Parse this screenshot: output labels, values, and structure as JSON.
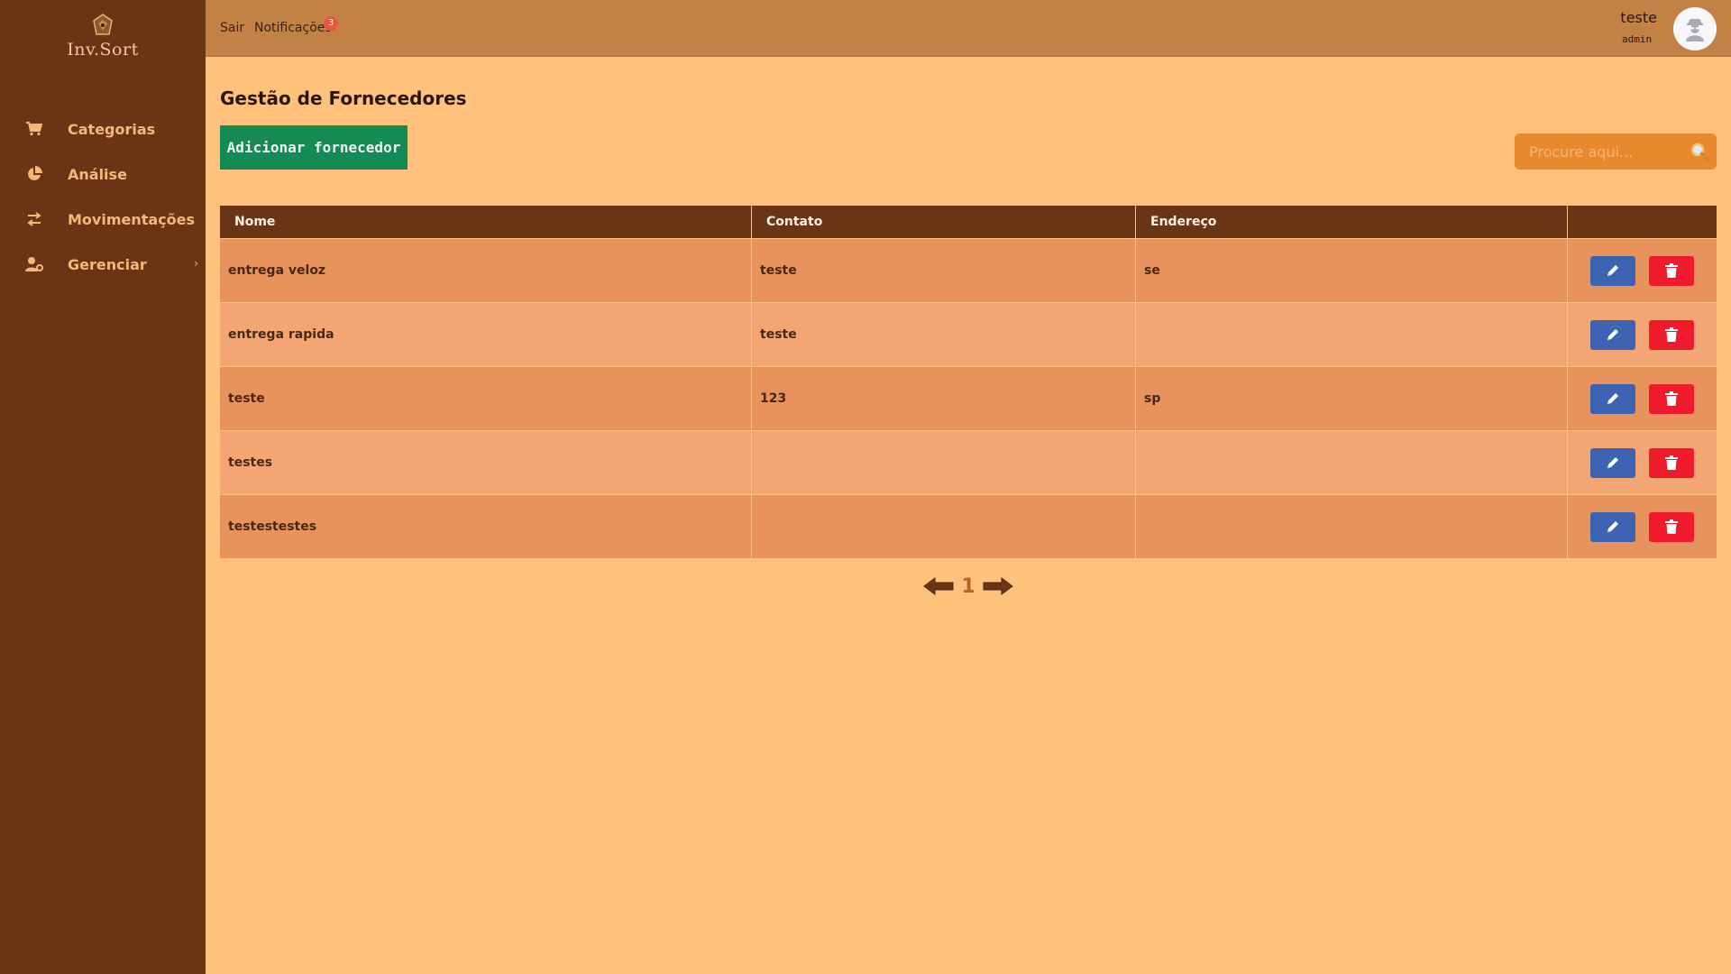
{
  "app": {
    "logo_text": "Inv.Sort"
  },
  "sidebar": {
    "items": [
      {
        "label": "Categorias",
        "icon": "cart-icon"
      },
      {
        "label": "Análise",
        "icon": "pie-chart-icon"
      },
      {
        "label": "Movimentações",
        "icon": "swap-arrows-icon"
      },
      {
        "label": "Gerenciar",
        "icon": "user-gear-icon",
        "has_submenu": true
      }
    ]
  },
  "header": {
    "logout": "Sair",
    "notifications": "Notificações",
    "notification_count": "3",
    "user_name": "teste",
    "user_role": "admin"
  },
  "main": {
    "title": "Gestão de Fornecedores",
    "add_button": "Adicionar fornecedor",
    "search_placeholder": "Procure aqui..."
  },
  "table": {
    "columns": [
      "Nome",
      "Contato",
      "Endereço",
      ""
    ],
    "rows": [
      {
        "nome": "entrega veloz",
        "contato": "teste",
        "endereco": "se"
      },
      {
        "nome": "entrega rapida",
        "contato": "teste",
        "endereco": ""
      },
      {
        "nome": "teste",
        "contato": "123",
        "endereco": "sp"
      },
      {
        "nome": "testes",
        "contato": "",
        "endereco": ""
      },
      {
        "nome": "testestestes",
        "contato": "",
        "endereco": ""
      }
    ]
  },
  "pagination": {
    "current_page": "1"
  },
  "colors": {
    "sidebar": "#6a3515",
    "header": "#c38245",
    "background": "#ffc27c",
    "add_button": "#148a54",
    "edit_button": "#3d63b3",
    "delete_button": "#ef1b2d"
  }
}
